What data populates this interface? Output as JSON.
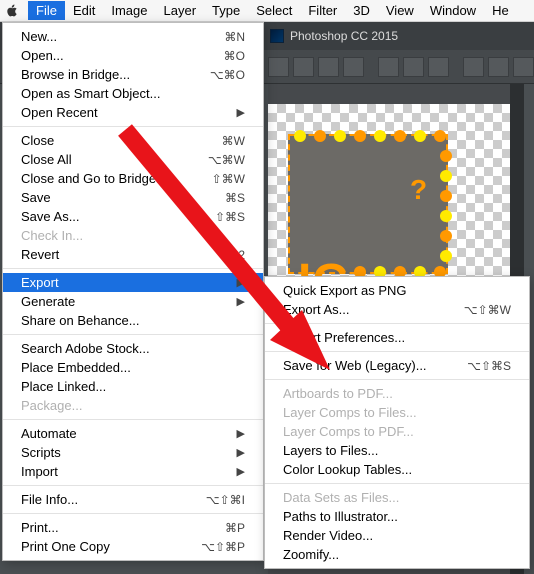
{
  "menubar": {
    "items": [
      "File",
      "Edit",
      "Image",
      "Layer",
      "Type",
      "Select",
      "Filter",
      "3D",
      "View",
      "Window",
      "He"
    ]
  },
  "app": {
    "title": "Photoshop CC 2015"
  },
  "menu_file": {
    "groups": [
      [
        {
          "label": "New...",
          "kb": "⌘N"
        },
        {
          "label": "Open...",
          "kb": "⌘O"
        },
        {
          "label": "Browse in Bridge...",
          "kb": "⌥⌘O"
        },
        {
          "label": "Open as Smart Object...",
          "kb": ""
        },
        {
          "label": "Open Recent",
          "kb": "",
          "sub": true
        }
      ],
      [
        {
          "label": "Close",
          "kb": "⌘W"
        },
        {
          "label": "Close All",
          "kb": "⌥⌘W"
        },
        {
          "label": "Close and Go to Bridge...",
          "kb": "⇧⌘W"
        },
        {
          "label": "Save",
          "kb": "⌘S"
        },
        {
          "label": "Save As...",
          "kb": "⇧⌘S"
        },
        {
          "label": "Check In...",
          "kb": "",
          "disabled": true
        },
        {
          "label": "Revert",
          "kb": "F12"
        }
      ],
      [
        {
          "label": "Export",
          "kb": "",
          "sub": true,
          "hl": true
        },
        {
          "label": "Generate",
          "kb": "",
          "sub": true
        },
        {
          "label": "Share on Behance...",
          "kb": ""
        }
      ],
      [
        {
          "label": "Search Adobe Stock...",
          "kb": ""
        },
        {
          "label": "Place Embedded...",
          "kb": ""
        },
        {
          "label": "Place Linked...",
          "kb": ""
        },
        {
          "label": "Package...",
          "kb": "",
          "disabled": true
        }
      ],
      [
        {
          "label": "Automate",
          "kb": "",
          "sub": true
        },
        {
          "label": "Scripts",
          "kb": "",
          "sub": true
        },
        {
          "label": "Import",
          "kb": "",
          "sub": true
        }
      ],
      [
        {
          "label": "File Info...",
          "kb": "⌥⇧⌘I"
        }
      ],
      [
        {
          "label": "Print...",
          "kb": "⌘P"
        },
        {
          "label": "Print One Copy",
          "kb": "⌥⇧⌘P"
        }
      ]
    ]
  },
  "menu_export": {
    "groups": [
      [
        {
          "label": "Quick Export as PNG",
          "kb": ""
        },
        {
          "label": "Export As...",
          "kb": "⌥⇧⌘W"
        }
      ],
      [
        {
          "label": "Export Preferences...",
          "kb": ""
        }
      ],
      [
        {
          "label": "Save for Web (Legacy)...",
          "kb": "⌥⇧⌘S"
        }
      ],
      [
        {
          "label": "Artboards to PDF...",
          "kb": "",
          "disabled": true
        },
        {
          "label": "Layer Comps to Files...",
          "kb": "",
          "disabled": true
        },
        {
          "label": "Layer Comps to PDF...",
          "kb": "",
          "disabled": true
        },
        {
          "label": "Layers to Files...",
          "kb": ""
        },
        {
          "label": "Color Lookup Tables...",
          "kb": ""
        }
      ],
      [
        {
          "label": "Data Sets as Files...",
          "kb": "",
          "disabled": true
        },
        {
          "label": "Paths to Illustrator...",
          "kb": ""
        },
        {
          "label": "Render Video...",
          "kb": ""
        },
        {
          "label": "Zoomify...",
          "kb": ""
        }
      ]
    ]
  },
  "canvas": {
    "text": "IG",
    "q": "?"
  }
}
